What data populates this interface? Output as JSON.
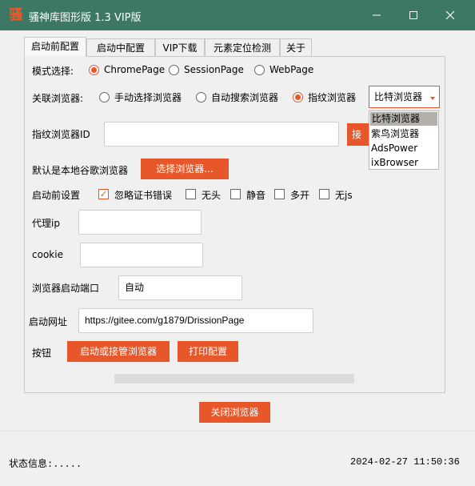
{
  "window": {
    "icon_char": "骚",
    "title": "骚神库图形版 1.3  VIP版"
  },
  "tabs": [
    {
      "label": "启动前配置",
      "active": true
    },
    {
      "label": "启动中配置",
      "active": false
    },
    {
      "label": "VIP下载",
      "active": false
    },
    {
      "label": "元素定位检测",
      "active": false
    },
    {
      "label": "关于",
      "active": false
    }
  ],
  "mode": {
    "label": "模式选择:",
    "options": [
      "ChromePage",
      "SessionPage",
      "WebPage"
    ],
    "selected": "ChromePage"
  },
  "browser_link": {
    "label": "关联浏览器:",
    "options": [
      "手动选择浏览器",
      "自动搜索浏览器",
      "指纹浏览器"
    ],
    "selected": "指纹浏览器",
    "select_value": "比特浏览器",
    "dropdown_options": [
      "比特浏览器",
      "紫鸟浏览器",
      "AdsPower",
      "ixBrowser"
    ]
  },
  "fingerprint_id": {
    "label": "指纹浏览器ID",
    "value": "",
    "button_label": "接"
  },
  "default_browser": {
    "label": "默认是本地谷歌浏览器",
    "button_label": "选择浏览器..."
  },
  "pre_start": {
    "label": "启动前设置",
    "options": [
      {
        "label": "忽略证书错误",
        "checked": true
      },
      {
        "label": "无头",
        "checked": false
      },
      {
        "label": "静音",
        "checked": false
      },
      {
        "label": "多开",
        "checked": false
      },
      {
        "label": "无js",
        "checked": false
      }
    ]
  },
  "proxy": {
    "label": "代理ip",
    "value": ""
  },
  "cookie": {
    "label": "cookie",
    "value": ""
  },
  "port": {
    "label": "浏览器启动端口",
    "value": "自动"
  },
  "url": {
    "label": "启动网址",
    "value": "https://gitee.com/g1879/DrissionPage"
  },
  "buttons": {
    "label": "按钮",
    "start_label": "启动或接管浏览器",
    "print_label": "打印配置"
  },
  "close_browser_label": "关闭浏览器",
  "progress": 0,
  "status": {
    "text": "状态信息:.....",
    "time": "2024-02-27 11:50:36"
  },
  "colors": {
    "accent": "#e8572a",
    "titlebar": "#3c7863"
  }
}
